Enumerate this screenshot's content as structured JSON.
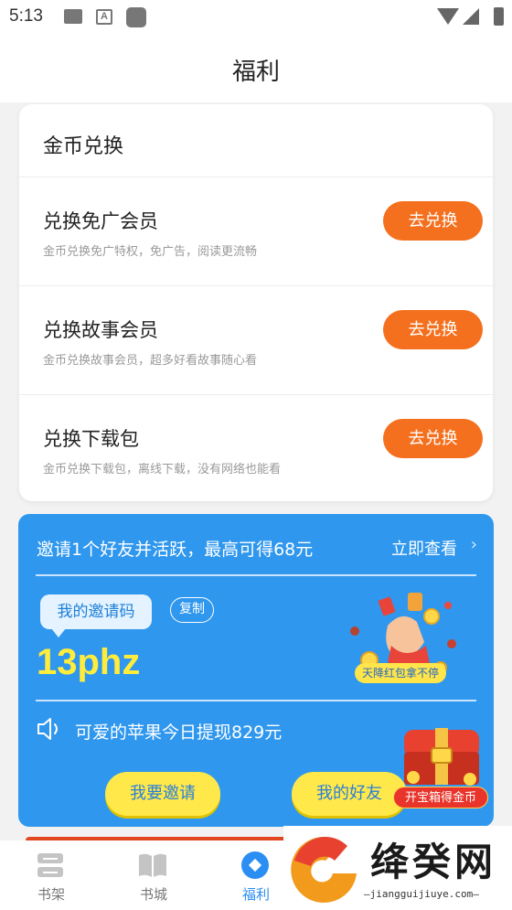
{
  "status_bar": {
    "time": "5:13"
  },
  "header": {
    "title": "福利"
  },
  "coin_exchange": {
    "title": "金币兑换",
    "items": [
      {
        "name": "兑换免广会员",
        "desc": "金币兑换免广特权，免广告，阅读更流畅",
        "button": "去兑换"
      },
      {
        "name": "兑换故事会员",
        "desc": "金币兑换故事会员，超多好看故事随心看",
        "button": "去兑换"
      },
      {
        "name": "兑换下载包",
        "desc": "金币兑换下载包，离线下载，没有网络也能看",
        "button": "去兑换"
      }
    ]
  },
  "invite": {
    "headline": "邀请1个好友并活跃，最高可得68元",
    "more_link": "立即查看",
    "code_label": "我的邀请码",
    "copy_button": "复制",
    "code": "13phz",
    "illustration_label": "天降红包拿不停",
    "news": "可爱的苹果今日提现829元",
    "invite_button": "我要邀请",
    "friends_button": "我的好友"
  },
  "chest": {
    "label": "开宝箱得金币"
  },
  "bottom_nav": {
    "items": [
      {
        "label": "书架",
        "icon": "bookshelf-icon",
        "active": false
      },
      {
        "label": "书城",
        "icon": "open-book-icon",
        "active": false
      },
      {
        "label": "福利",
        "icon": "welfare-diamond-icon",
        "active": true
      }
    ]
  },
  "watermark": {
    "title": "绛癸网",
    "url": "—jiangguijiuye.com—"
  },
  "colors": {
    "accent_orange": "#f4701e",
    "invite_blue": "#2f97ee",
    "code_yellow": "#ffec3d",
    "nav_active": "#2b8ef2"
  }
}
